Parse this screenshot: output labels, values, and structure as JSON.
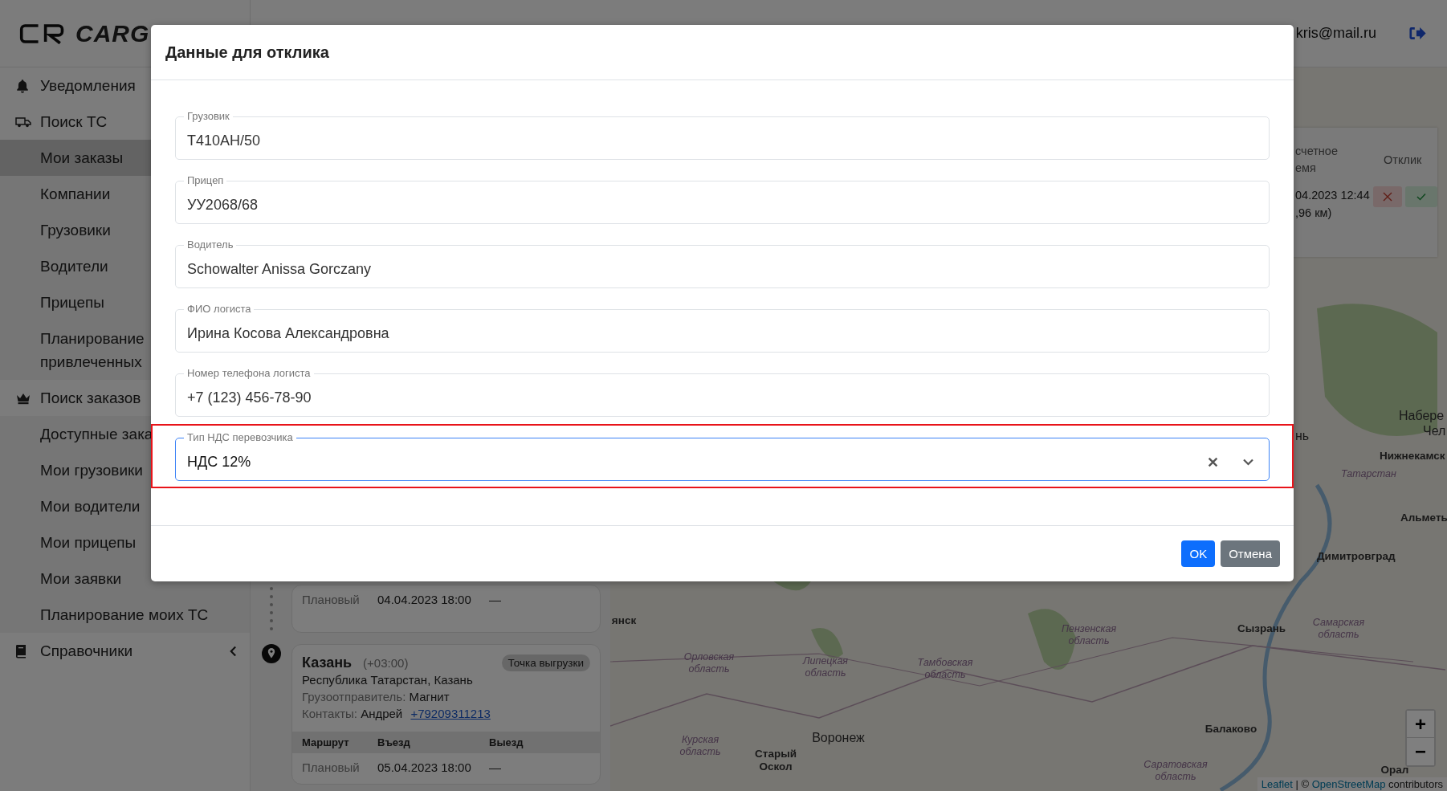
{
  "logo": {
    "text": "CARG"
  },
  "sidebar": {
    "items": [
      {
        "label": "Уведомления",
        "selected": false
      },
      {
        "label": "Поиск ТС",
        "selected": false,
        "expanded": true,
        "children": [
          {
            "label": "Мои заказы",
            "selected": true
          },
          {
            "label": "Компании",
            "selected": false
          },
          {
            "label": "Грузовики",
            "selected": false
          },
          {
            "label": "Водители",
            "selected": false
          },
          {
            "label": "Прицепы",
            "selected": false
          },
          {
            "label": "Планирование привлеченных",
            "selected": false
          }
        ]
      },
      {
        "label": "Поиск заказов",
        "selected": false,
        "expanded": true,
        "children": [
          {
            "label": "Доступные зака",
            "selected": false
          },
          {
            "label": "Мои грузовики",
            "selected": false
          },
          {
            "label": "Мои водители",
            "selected": false
          },
          {
            "label": "Мои прицепы",
            "selected": false
          },
          {
            "label": "Мои заявки",
            "selected": false
          },
          {
            "label": "Планирование моих ТС",
            "selected": false
          }
        ]
      },
      {
        "label": "Справочники",
        "selected": false,
        "expanded": false
      }
    ]
  },
  "header": {
    "user_email": "kris@mail.ru"
  },
  "route": {
    "stops": [
      {
        "kind": "partial",
        "schedule": {
          "type": "Плановый",
          "arrival": "04.04.2023 18:00",
          "departure": "—"
        }
      },
      {
        "kind": "full",
        "city": "Казань",
        "timezone": "(+03:00)",
        "badge": "Точка выгрузки",
        "address": "Республика Татарстан, Казань",
        "shipper_label": "Грузоотправитель:",
        "shipper": "Магнит",
        "contacts_label": "Контакты:",
        "contact_name": "Андрей",
        "contact_phone": "+79209311213",
        "columns": [
          "Маршрут",
          "Въезд",
          "Выезд"
        ],
        "schedule": {
          "type": "Плановый",
          "arrival": "05.04.2023 18:00",
          "departure": "—"
        }
      }
    ]
  },
  "map": {
    "labels": [
      {
        "text": "янск",
        "kind": "city"
      },
      {
        "text": "Орловская область",
        "kind": "region"
      },
      {
        "text": "Липецкая область",
        "kind": "region"
      },
      {
        "text": "Тамбовская область",
        "kind": "region"
      },
      {
        "text": "Пензенская область",
        "kind": "region"
      },
      {
        "text": "Сызрань",
        "kind": "city"
      },
      {
        "text": "Самарская область",
        "kind": "region"
      },
      {
        "text": "Курская область",
        "kind": "region"
      },
      {
        "text": "Воронеж",
        "kind": "bigcity"
      },
      {
        "text": "Старый Оскол",
        "kind": "city"
      },
      {
        "text": "Балаково",
        "kind": "city"
      },
      {
        "text": "Саратовская область",
        "kind": "region"
      },
      {
        "text": "Орал",
        "kind": "city"
      },
      {
        "text": "Набере",
        "kind": "bigcity"
      },
      {
        "text": "Чел",
        "kind": "bigcity"
      },
      {
        "text": "нь",
        "kind": "bigcity"
      },
      {
        "text": "Нижнекамск",
        "kind": "city"
      },
      {
        "text": "Татарстан",
        "kind": "region"
      },
      {
        "text": "Альметь",
        "kind": "city"
      },
      {
        "text": "Димитровград",
        "kind": "city"
      }
    ],
    "response_table": {
      "columns": [
        [
          "счетное",
          "емя"
        ],
        [
          "Отклик"
        ]
      ],
      "rows": [
        {
          "column_1": [
            "04.2023 12:44",
            ",96 км)"
          ]
        }
      ]
    },
    "zoom_controls": [
      "+",
      "−"
    ],
    "attribution": {
      "leaflet_link": "Leaflet",
      "separator": "| ©",
      "osm_link": "OpenStreetMap",
      "suffix": "contributors"
    }
  },
  "modal": {
    "title": "Данные для отклика",
    "fields": [
      {
        "kind": "text",
        "label": "Грузовик",
        "value": "Т410АН/50",
        "focused": false,
        "highlighted": false
      },
      {
        "kind": "text",
        "label": "Прицеп",
        "value": "УУ2068/68",
        "focused": false,
        "highlighted": false
      },
      {
        "kind": "text",
        "label": "Водитель",
        "value": "Schowalter Anissa Gorczany",
        "focused": false,
        "highlighted": false
      },
      {
        "kind": "text",
        "label": "ФИО логиста",
        "value": "Ирина Косова Александровна",
        "focused": false,
        "highlighted": false
      },
      {
        "kind": "text",
        "label": "Номер телефона логиста",
        "value": "+7 (123) 456-78-90",
        "focused": false,
        "highlighted": false
      },
      {
        "kind": "select",
        "label": "Тип НДС перевозчика",
        "value": "НДС 12%",
        "focused": true,
        "highlighted": true
      }
    ],
    "buttons": [
      {
        "kind": "primary",
        "label": "OK"
      },
      {
        "kind": "secondary",
        "label": "Отмена"
      }
    ]
  }
}
